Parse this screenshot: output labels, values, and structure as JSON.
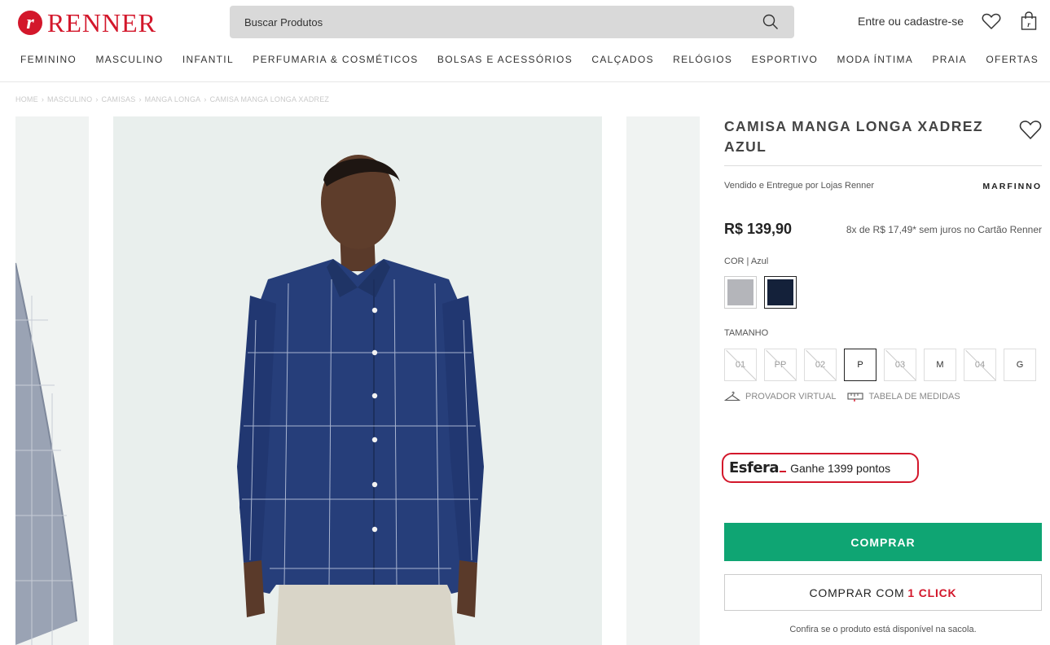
{
  "header": {
    "logo_mark": "r",
    "logo_text": "RENNER",
    "search_placeholder": "Buscar Produtos",
    "login_label": "Entre ou cadastre-se"
  },
  "nav": [
    "FEMININO",
    "MASCULINO",
    "INFANTIL",
    "PERFUMARIA & COSMÉTICOS",
    "BOLSAS E ACESSÓRIOS",
    "CALÇADOS",
    "RELÓGIOS",
    "ESPORTIVO",
    "MODA ÍNTIMA",
    "PRAIA",
    "OFERTAS"
  ],
  "breadcrumb": [
    "HOME",
    "MASCULINO",
    "CAMISAS",
    "MANGA LONGA",
    "CAMISA MANGA LONGA XADREZ"
  ],
  "product": {
    "title": "CAMISA MANGA LONGA XADREZ AZUL",
    "sold_by": "Vendido e Entregue por Lojas Renner",
    "brand": "MARFINNO",
    "price": "R$ 139,90",
    "installments": "8x de R$ 17,49* sem juros no Cartão Renner",
    "color_label": "COR",
    "color_value": "Azul",
    "colors": [
      {
        "name": "cinza",
        "hex": "#b4b5ba",
        "selected": false
      },
      {
        "name": "azul",
        "hex": "#14213a",
        "selected": true
      }
    ],
    "size_label": "TAMANHO",
    "sizes": [
      {
        "label": "01",
        "state": "disabled"
      },
      {
        "label": "PP",
        "state": "disabled"
      },
      {
        "label": "02",
        "state": "disabled"
      },
      {
        "label": "P",
        "state": "selected"
      },
      {
        "label": "03",
        "state": "disabled"
      },
      {
        "label": "M",
        "state": "available"
      },
      {
        "label": "04",
        "state": "disabled"
      },
      {
        "label": "G",
        "state": "available"
      }
    ],
    "virtual_fitting": "PROVADOR VIRTUAL",
    "size_chart": "TABELA DE MEDIDAS",
    "esfera_logo": "Esfera",
    "esfera_points": "Ganhe 1399 pontos",
    "buy_label": "COMPRAR",
    "buy_one_click_prefix": "COMPRAR COM",
    "buy_one_click_highlight": "1 CLICK",
    "availability_note": "Confira se o produto está disponível na sacola."
  },
  "colors": {
    "brand_red": "#d3172b",
    "buy_green": "#0fa573"
  }
}
